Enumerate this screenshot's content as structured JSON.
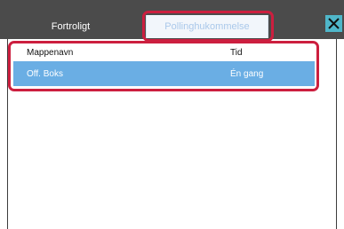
{
  "tabs": [
    {
      "label": "Fortroligt",
      "active": false
    },
    {
      "label": "Pollinghukommelse",
      "active": true
    }
  ],
  "close_icon": "close-x-icon",
  "table": {
    "columns": [
      "Mappenavn",
      "Tid"
    ],
    "rows": [
      {
        "name": "Off. Boks",
        "time": "Én gang",
        "selected": true
      }
    ]
  },
  "colors": {
    "tabbar": "#4b4b4b",
    "selected_row": "#6aaee4",
    "close_button": "#4fb6c9",
    "highlight": "#cc1f3f"
  }
}
